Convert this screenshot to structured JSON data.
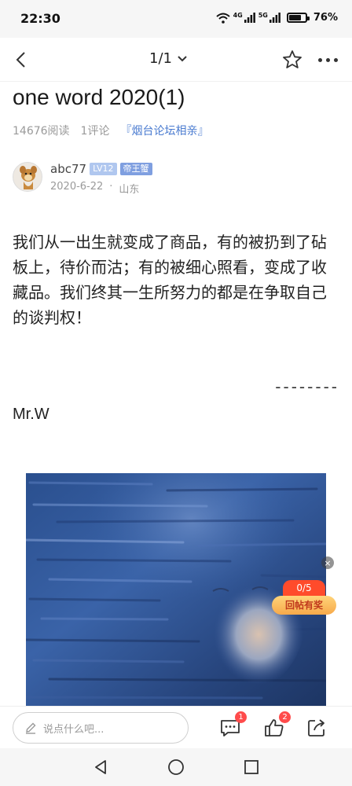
{
  "status": {
    "time": "22:30",
    "net1": "4G",
    "net2": "5G",
    "battery_percent": "76%",
    "battery_level": 0.76
  },
  "nav": {
    "page_indicator": "1/1"
  },
  "post": {
    "title": "one word 2020(1)",
    "views": "14676阅读",
    "comments": "1评论",
    "forum": "『烟台论坛相亲』",
    "author": "abc77",
    "level": "LV12",
    "rank": "帝王蟹",
    "date": "2020-6-22",
    "separator": "·",
    "location": "山东",
    "body": "我们从一出生就变成了商品，有的被扔到了砧板上，待价而沽；有的被细心照看，变成了收藏品。我们终其一生所努力的都是在争取自己的谈判权！",
    "divider": "--------",
    "signature": "Mr.W"
  },
  "reward": {
    "count": "0/5",
    "label": "回帖有奖",
    "close": "×"
  },
  "bottom": {
    "comment_placeholder": "说点什么吧...",
    "comment_badge": "1",
    "like_badge": "2"
  },
  "colors": {
    "accent": "#4a7bd0",
    "badge_red": "#ff4b4b",
    "reward_red": "#ff4b2b"
  }
}
